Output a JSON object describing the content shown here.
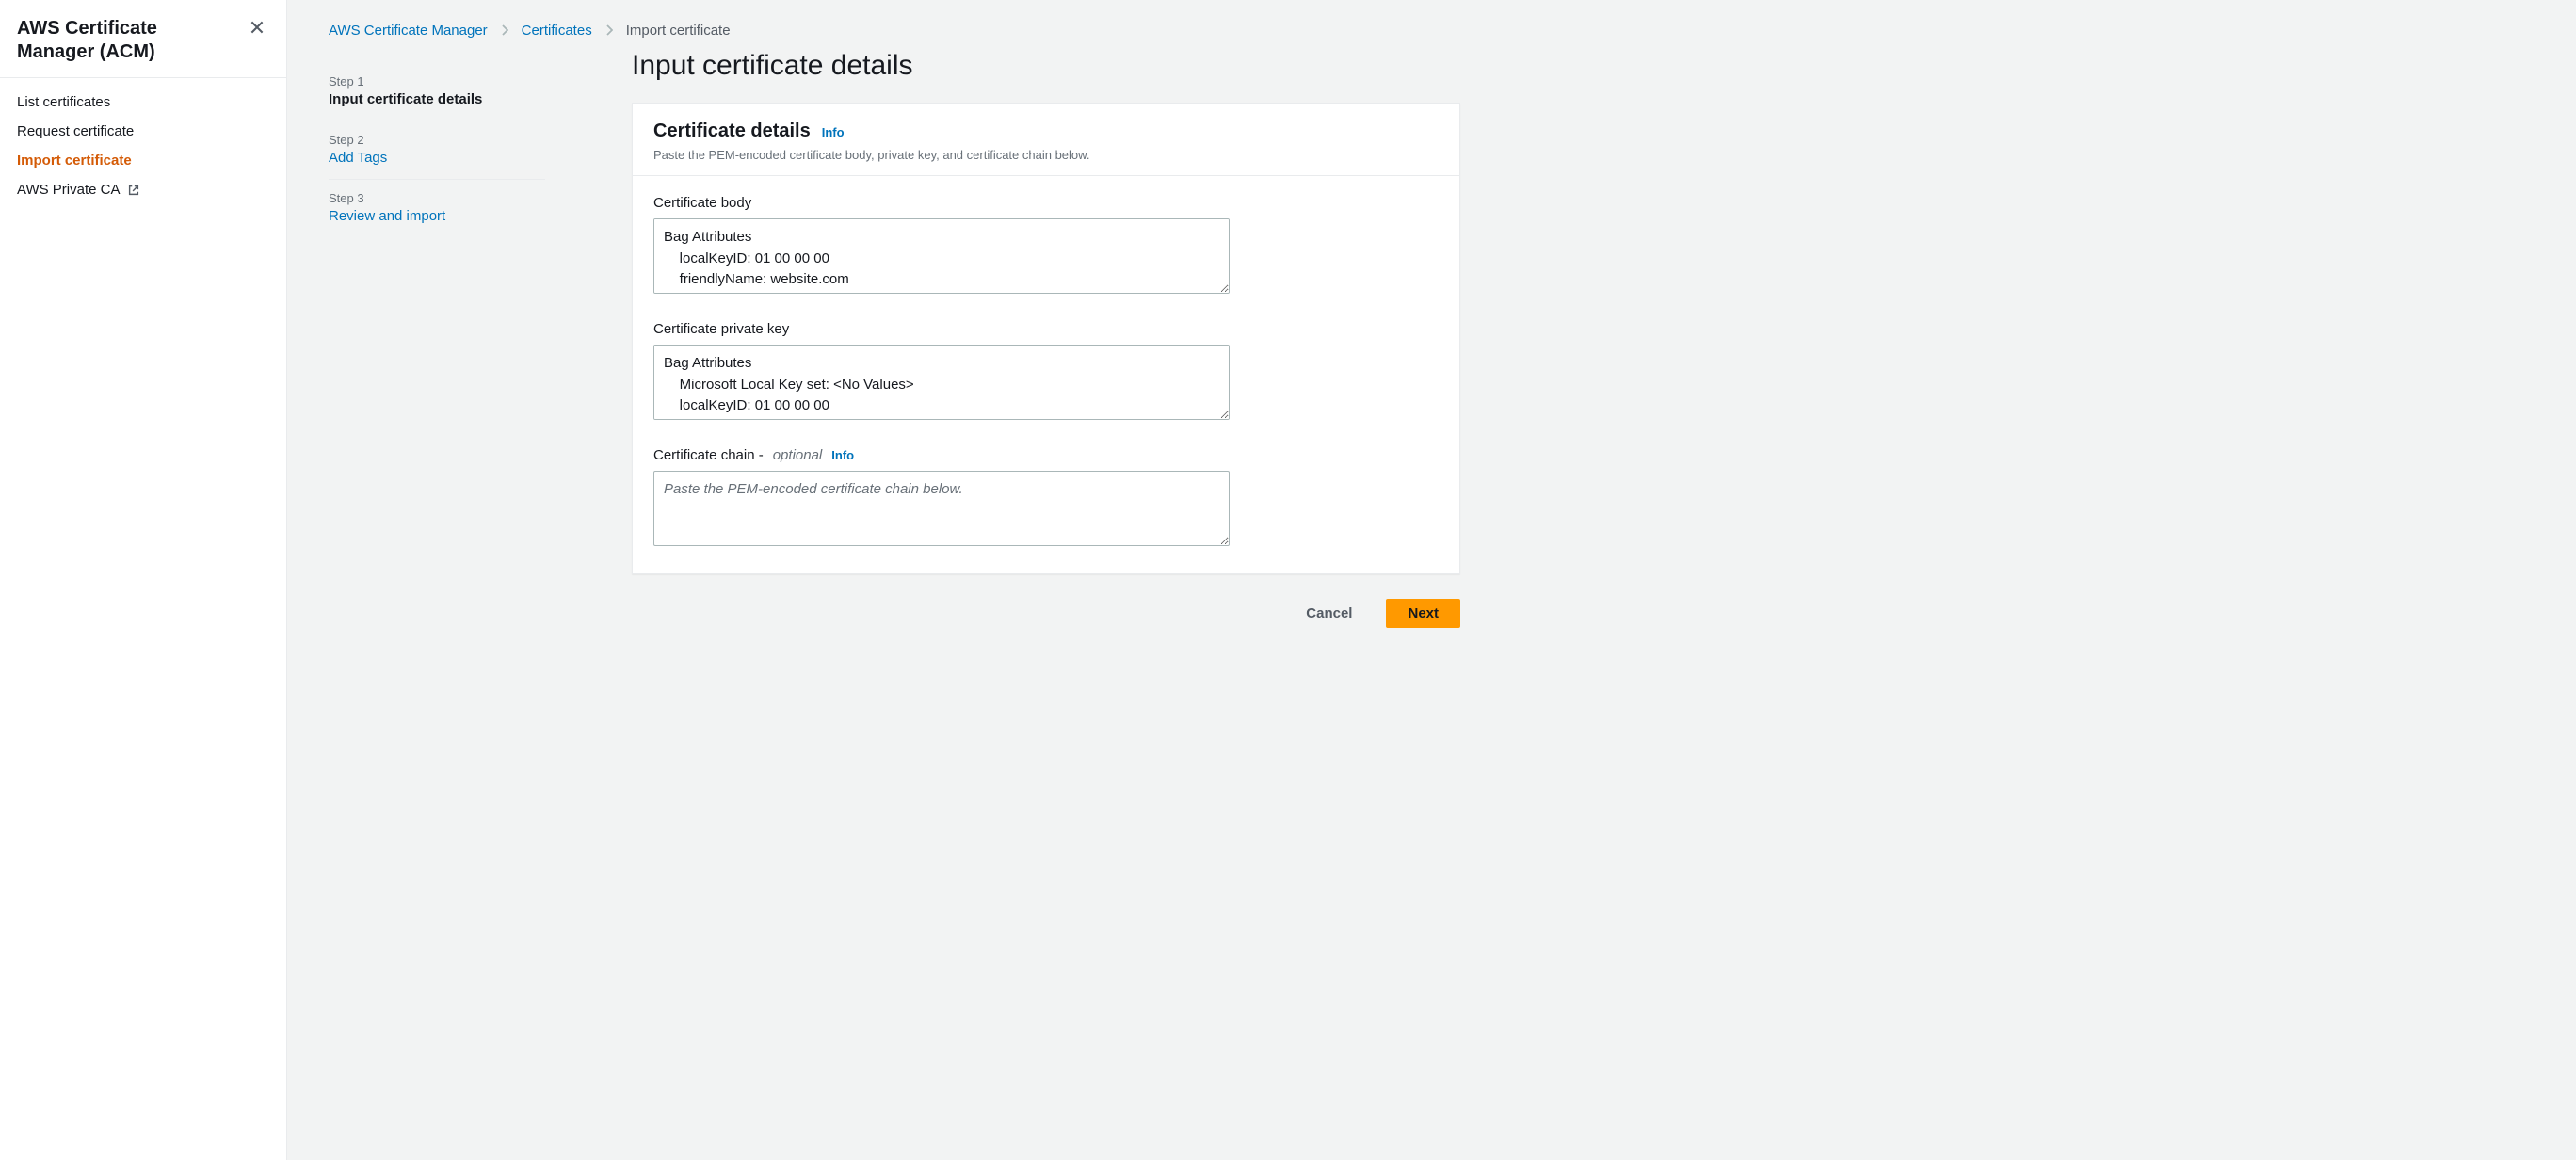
{
  "sidebar": {
    "title": "AWS Certificate Manager (ACM)",
    "items": [
      {
        "label": "List certificates",
        "active": false,
        "external": false
      },
      {
        "label": "Request certificate",
        "active": false,
        "external": false
      },
      {
        "label": "Import certificate",
        "active": true,
        "external": false
      },
      {
        "label": "AWS Private CA",
        "active": false,
        "external": true
      }
    ]
  },
  "breadcrumb": {
    "items": [
      {
        "label": "AWS Certificate Manager",
        "link": true
      },
      {
        "label": "Certificates",
        "link": true
      },
      {
        "label": "Import certificate",
        "link": false
      }
    ]
  },
  "wizard": {
    "steps": [
      {
        "label": "Step 1",
        "title": "Input certificate details",
        "current": true
      },
      {
        "label": "Step 2",
        "title": "Add Tags",
        "current": false
      },
      {
        "label": "Step 3",
        "title": "Review and import",
        "current": false
      }
    ]
  },
  "page": {
    "heading": "Input certificate details"
  },
  "panel": {
    "title": "Certificate details",
    "info": "Info",
    "description": "Paste the PEM-encoded certificate body, private key, and certificate chain below."
  },
  "fields": {
    "body": {
      "label": "Certificate body",
      "value": "Bag Attributes\n    localKeyID: 01 00 00 00\n    friendlyName: website.com"
    },
    "privateKey": {
      "label": "Certificate private key",
      "value": "Bag Attributes\n    Microsoft Local Key set: <No Values>\n    localKeyID: 01 00 00 00"
    },
    "chain": {
      "label": "Certificate chain - ",
      "optional": "optional",
      "info": "Info",
      "value": "",
      "placeholder": "Paste the PEM-encoded certificate chain below."
    }
  },
  "footer": {
    "cancel": "Cancel",
    "next": "Next"
  }
}
